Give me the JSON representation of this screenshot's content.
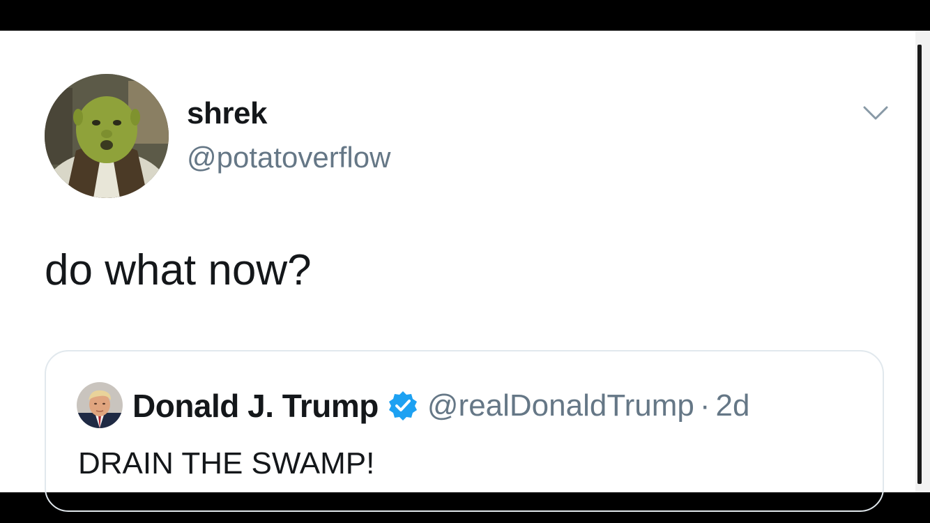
{
  "tweet": {
    "author": {
      "display_name": "shrek",
      "handle": "@potatoverflow",
      "avatar_icon": "shrek-avatar"
    },
    "menu_icon": "chevron-down-icon",
    "text": "do what now?",
    "quoted_tweet": {
      "author": {
        "display_name": "Donald J. Trump",
        "handle": "@realDonaldTrump",
        "verified": true,
        "avatar_icon": "trump-avatar"
      },
      "separator": "·",
      "time": "2d",
      "text": "DRAIN THE SWAMP!"
    }
  },
  "colors": {
    "primary_text": "#14171a",
    "secondary_text": "#657786",
    "verified_blue": "#1da1f2",
    "border": "#e1e8ed"
  }
}
